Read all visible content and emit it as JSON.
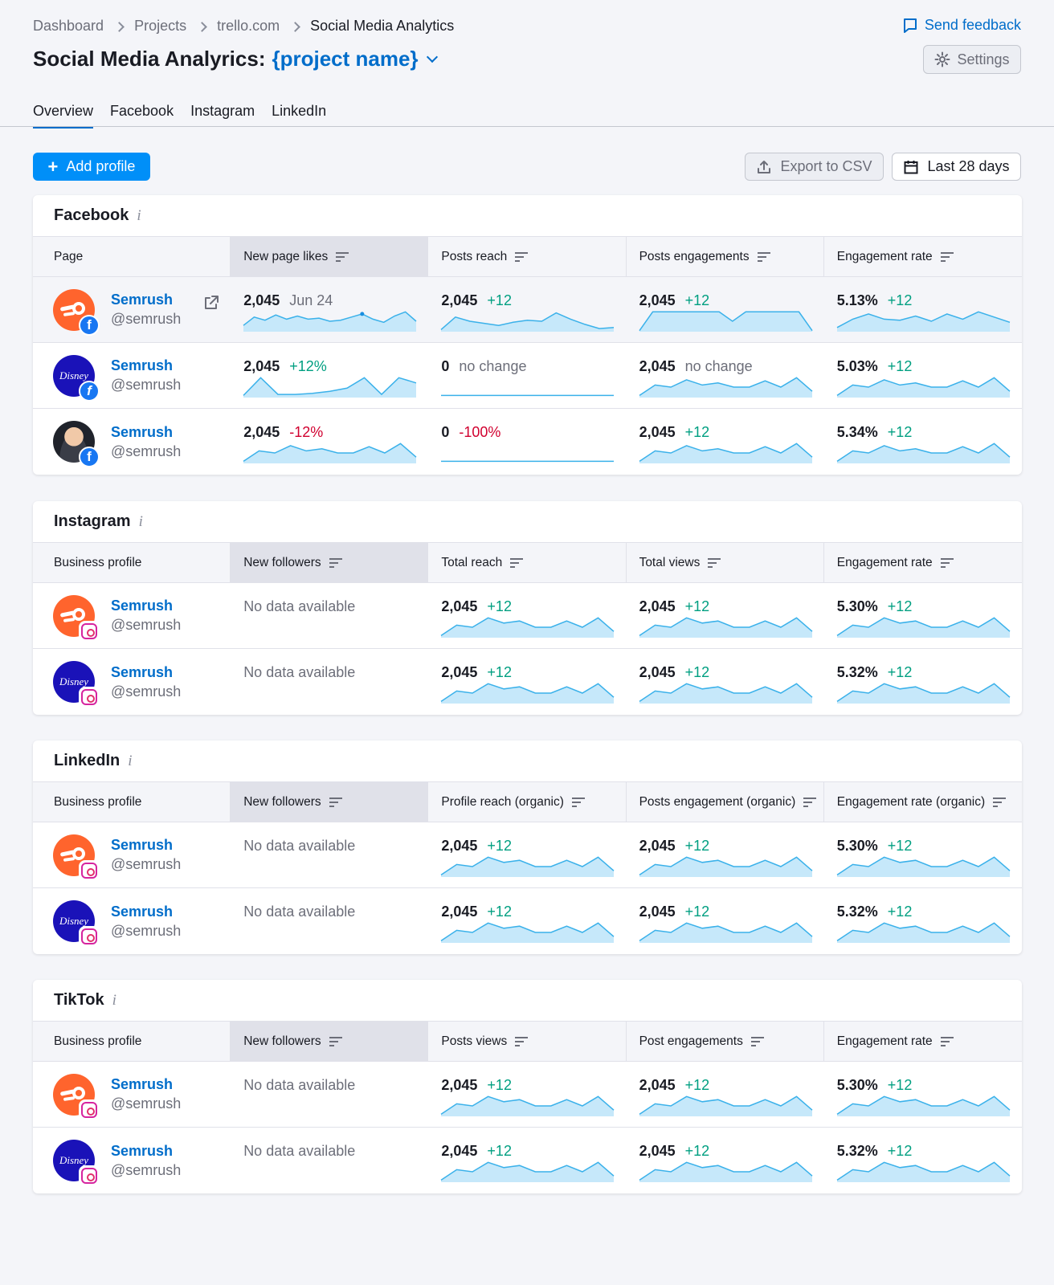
{
  "breadcrumb": [
    "Dashboard",
    "Projects",
    "trello.com",
    "Social Media Analytics"
  ],
  "feedback": "Send feedback",
  "title": {
    "prefix": "Social Media Analyrics:",
    "project": "{project name}"
  },
  "settings": "Settings",
  "tabs": [
    "Overview",
    "Facebook",
    "Instagram",
    "LinkedIn"
  ],
  "toolbar": {
    "add": "Add profile",
    "export": "Export to CSV",
    "date": "Last 28 days"
  },
  "colors": {
    "accent": "#006dca",
    "primary_button": "#008ff8",
    "positive": "#009f81",
    "negative": "#d1002f",
    "spark_line": "#3ab1ea",
    "spark_fill": "#c6e8fa"
  },
  "sections": [
    {
      "name": "Facebook",
      "headers": [
        "Page",
        "New page likes",
        "Posts reach",
        "Posts engagements",
        "Engagement rate"
      ],
      "rows": [
        {
          "avatar": "semrush-logo",
          "network": "facebook-icon",
          "name": "Semrush",
          "handle": "@semrush",
          "external_link": true,
          "highlight": true,
          "metrics": [
            {
              "value": "2,045",
              "delta": "Jun 24",
              "tone": "neutral",
              "spark": [
                0.3,
                0.7,
                0.55,
                0.8,
                0.6,
                0.75,
                0.6,
                0.65,
                0.5,
                0.55,
                0.7,
                0.85,
                0.6,
                0.45,
                0.75,
                0.95,
                0.5
              ],
              "marker": 11
            },
            {
              "value": "2,045",
              "delta": "+12",
              "tone": "pos",
              "spark": [
                0.1,
                0.7,
                0.5,
                0.4,
                0.3,
                0.45,
                0.55,
                0.5,
                0.9,
                0.6,
                0.35,
                0.15,
                0.2
              ]
            },
            {
              "value": "2,045",
              "delta": "+12",
              "tone": "pos",
              "spark": [
                0.05,
                0.95,
                0.95,
                0.95,
                0.95,
                0.95,
                0.95,
                0.5,
                0.95,
                0.95,
                0.95,
                0.95,
                0.95,
                0.05
              ],
              "shape": "plateau"
            },
            {
              "value": "5.13%",
              "delta": "+12",
              "tone": "pos",
              "spark": [
                0.2,
                0.6,
                0.85,
                0.6,
                0.55,
                0.75,
                0.5,
                0.85,
                0.6,
                0.95,
                0.7,
                0.45
              ]
            }
          ]
        },
        {
          "avatar": "disney-logo",
          "network": "facebook-icon",
          "name": "Semrush",
          "handle": "@semrush",
          "external_link": false,
          "highlight": false,
          "metrics": [
            {
              "value": "2,045",
              "delta": "+12%",
              "tone": "pos",
              "spark": [
                0.1,
                0.95,
                0.15,
                0.15,
                0.2,
                0.3,
                0.45,
                0.95,
                0.15,
                0.95,
                0.7
              ]
            },
            {
              "value": "0",
              "delta": "no change",
              "tone": "neutral",
              "spark": [
                0.1,
                0.1,
                0.1,
                0.1,
                0.1,
                0.1,
                0.1,
                0.1,
                0.1,
                0.1,
                0.1
              ],
              "shape": "flat"
            },
            {
              "value": "2,045",
              "delta": "no change",
              "tone": "neutral",
              "spark": [
                0.1,
                0.6,
                0.5,
                0.85,
                0.6,
                0.7,
                0.5,
                0.5,
                0.8,
                0.5,
                0.95,
                0.3
              ]
            },
            {
              "value": "5.03%",
              "delta": "+12",
              "tone": "pos",
              "spark": [
                0.1,
                0.6,
                0.5,
                0.85,
                0.6,
                0.7,
                0.5,
                0.5,
                0.8,
                0.5,
                0.95,
                0.3
              ]
            }
          ]
        },
        {
          "avatar": "person-photo",
          "network": "facebook-icon",
          "name": "Semrush",
          "handle": "@semrush",
          "external_link": false,
          "highlight": false,
          "metrics": [
            {
              "value": "2,045",
              "delta": "-12%",
              "tone": "neg",
              "spark": [
                0.1,
                0.6,
                0.5,
                0.85,
                0.6,
                0.7,
                0.5,
                0.5,
                0.8,
                0.5,
                0.95,
                0.3
              ]
            },
            {
              "value": "0",
              "delta": "-100%",
              "tone": "neg",
              "spark": [
                0.1,
                0.1,
                0.1,
                0.1,
                0.1,
                0.1,
                0.1,
                0.1,
                0.1,
                0.1,
                0.1
              ],
              "shape": "flat"
            },
            {
              "value": "2,045",
              "delta": "+12",
              "tone": "pos",
              "spark": [
                0.1,
                0.6,
                0.5,
                0.85,
                0.6,
                0.7,
                0.5,
                0.5,
                0.8,
                0.5,
                0.95,
                0.3
              ]
            },
            {
              "value": "5.34%",
              "delta": "+12",
              "tone": "pos",
              "spark": [
                0.1,
                0.6,
                0.5,
                0.85,
                0.6,
                0.7,
                0.5,
                0.5,
                0.8,
                0.5,
                0.95,
                0.3
              ]
            }
          ]
        }
      ]
    },
    {
      "name": "Instagram",
      "headers": [
        "Business profile",
        "New followers",
        "Total reach",
        "Total views",
        "Engagement rate"
      ],
      "rows": [
        {
          "avatar": "semrush-logo",
          "network": "instagram-icon",
          "name": "Semrush",
          "handle": "@semrush",
          "highlight": false,
          "metrics": [
            {
              "nodata": "No data available"
            },
            {
              "value": "2,045",
              "delta": "+12",
              "tone": "pos",
              "spark": [
                0.1,
                0.6,
                0.5,
                0.95,
                0.7,
                0.8,
                0.5,
                0.5,
                0.8,
                0.5,
                0.95,
                0.3
              ]
            },
            {
              "value": "2,045",
              "delta": "+12",
              "tone": "pos",
              "spark": [
                0.1,
                0.6,
                0.5,
                0.95,
                0.7,
                0.8,
                0.5,
                0.5,
                0.8,
                0.5,
                0.95,
                0.3
              ]
            },
            {
              "value": "5.30%",
              "delta": "+12",
              "tone": "pos",
              "spark": [
                0.1,
                0.6,
                0.5,
                0.95,
                0.7,
                0.8,
                0.5,
                0.5,
                0.8,
                0.5,
                0.95,
                0.3
              ]
            }
          ]
        },
        {
          "avatar": "disney-logo",
          "network": "instagram-icon",
          "name": "Semrush",
          "handle": "@semrush",
          "highlight": false,
          "metrics": [
            {
              "nodata": "No data available"
            },
            {
              "value": "2,045",
              "delta": "+12",
              "tone": "pos",
              "spark": [
                0.1,
                0.6,
                0.5,
                0.95,
                0.7,
                0.8,
                0.5,
                0.5,
                0.8,
                0.5,
                0.95,
                0.3
              ]
            },
            {
              "value": "2,045",
              "delta": "+12",
              "tone": "pos",
              "spark": [
                0.1,
                0.6,
                0.5,
                0.95,
                0.7,
                0.8,
                0.5,
                0.5,
                0.8,
                0.5,
                0.95,
                0.3
              ]
            },
            {
              "value": "5.32%",
              "delta": "+12",
              "tone": "pos",
              "spark": [
                0.1,
                0.6,
                0.5,
                0.95,
                0.7,
                0.8,
                0.5,
                0.5,
                0.8,
                0.5,
                0.95,
                0.3
              ]
            }
          ]
        }
      ]
    },
    {
      "name": "LinkedIn",
      "headers": [
        "Business profile",
        "New followers",
        "Profile reach (organic)",
        "Posts engagement (organic)",
        "Engagement rate (organic)"
      ],
      "rows": [
        {
          "avatar": "semrush-logo",
          "network": "instagram-icon",
          "name": "Semrush",
          "handle": "@semrush",
          "highlight": false,
          "metrics": [
            {
              "nodata": "No data available"
            },
            {
              "value": "2,045",
              "delta": "+12",
              "tone": "pos",
              "spark": [
                0.1,
                0.6,
                0.5,
                0.95,
                0.7,
                0.8,
                0.5,
                0.5,
                0.8,
                0.5,
                0.95,
                0.3
              ]
            },
            {
              "value": "2,045",
              "delta": "+12",
              "tone": "pos",
              "spark": [
                0.1,
                0.6,
                0.5,
                0.95,
                0.7,
                0.8,
                0.5,
                0.5,
                0.8,
                0.5,
                0.95,
                0.3
              ]
            },
            {
              "value": "5.30%",
              "delta": "+12",
              "tone": "pos",
              "spark": [
                0.1,
                0.6,
                0.5,
                0.95,
                0.7,
                0.8,
                0.5,
                0.5,
                0.8,
                0.5,
                0.95,
                0.3
              ]
            }
          ]
        },
        {
          "avatar": "disney-logo",
          "network": "instagram-icon",
          "name": "Semrush",
          "handle": "@semrush",
          "highlight": false,
          "metrics": [
            {
              "nodata": "No data available"
            },
            {
              "value": "2,045",
              "delta": "+12",
              "tone": "pos",
              "spark": [
                0.1,
                0.6,
                0.5,
                0.95,
                0.7,
                0.8,
                0.5,
                0.5,
                0.8,
                0.5,
                0.95,
                0.3
              ]
            },
            {
              "value": "2,045",
              "delta": "+12",
              "tone": "pos",
              "spark": [
                0.1,
                0.6,
                0.5,
                0.95,
                0.7,
                0.8,
                0.5,
                0.5,
                0.8,
                0.5,
                0.95,
                0.3
              ]
            },
            {
              "value": "5.32%",
              "delta": "+12",
              "tone": "pos",
              "spark": [
                0.1,
                0.6,
                0.5,
                0.95,
                0.7,
                0.8,
                0.5,
                0.5,
                0.8,
                0.5,
                0.95,
                0.3
              ]
            }
          ]
        }
      ]
    },
    {
      "name": "TikTok",
      "headers": [
        "Business profile",
        "New followers",
        "Posts views",
        "Post engagements",
        "Engagement rate"
      ],
      "rows": [
        {
          "avatar": "semrush-logo",
          "network": "instagram-icon",
          "name": "Semrush",
          "handle": "@semrush",
          "highlight": false,
          "metrics": [
            {
              "nodata": "No data available"
            },
            {
              "value": "2,045",
              "delta": "+12",
              "tone": "pos",
              "spark": [
                0.1,
                0.6,
                0.5,
                0.95,
                0.7,
                0.8,
                0.5,
                0.5,
                0.8,
                0.5,
                0.95,
                0.3
              ]
            },
            {
              "value": "2,045",
              "delta": "+12",
              "tone": "pos",
              "spark": [
                0.1,
                0.6,
                0.5,
                0.95,
                0.7,
                0.8,
                0.5,
                0.5,
                0.8,
                0.5,
                0.95,
                0.3
              ]
            },
            {
              "value": "5.30%",
              "delta": "+12",
              "tone": "pos",
              "spark": [
                0.1,
                0.6,
                0.5,
                0.95,
                0.7,
                0.8,
                0.5,
                0.5,
                0.8,
                0.5,
                0.95,
                0.3
              ]
            }
          ]
        },
        {
          "avatar": "disney-logo",
          "network": "instagram-icon",
          "name": "Semrush",
          "handle": "@semrush",
          "highlight": false,
          "metrics": [
            {
              "nodata": "No data available"
            },
            {
              "value": "2,045",
              "delta": "+12",
              "tone": "pos",
              "spark": [
                0.1,
                0.6,
                0.5,
                0.95,
                0.7,
                0.8,
                0.5,
                0.5,
                0.8,
                0.5,
                0.95,
                0.3
              ]
            },
            {
              "value": "2,045",
              "delta": "+12",
              "tone": "pos",
              "spark": [
                0.1,
                0.6,
                0.5,
                0.95,
                0.7,
                0.8,
                0.5,
                0.5,
                0.8,
                0.5,
                0.95,
                0.3
              ]
            },
            {
              "value": "5.32%",
              "delta": "+12",
              "tone": "pos",
              "spark": [
                0.1,
                0.6,
                0.5,
                0.95,
                0.7,
                0.8,
                0.5,
                0.5,
                0.8,
                0.5,
                0.95,
                0.3
              ]
            }
          ]
        }
      ]
    }
  ]
}
